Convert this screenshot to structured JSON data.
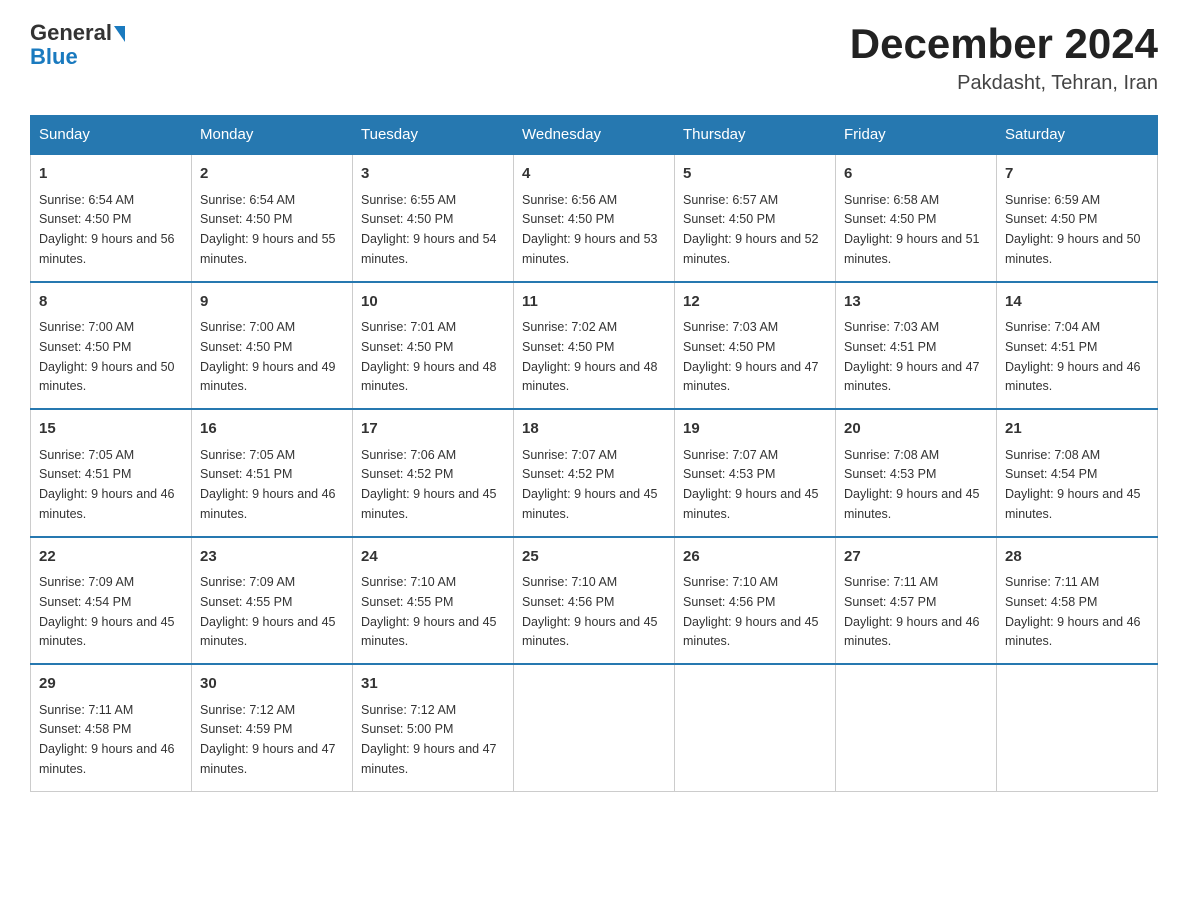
{
  "header": {
    "logo_text_main": "General",
    "logo_text_blue": "Blue",
    "month_title": "December 2024",
    "location": "Pakdasht, Tehran, Iran"
  },
  "weekdays": [
    "Sunday",
    "Monday",
    "Tuesday",
    "Wednesday",
    "Thursday",
    "Friday",
    "Saturday"
  ],
  "weeks": [
    [
      {
        "day": "1",
        "sunrise": "6:54 AM",
        "sunset": "4:50 PM",
        "daylight": "9 hours and 56 minutes."
      },
      {
        "day": "2",
        "sunrise": "6:54 AM",
        "sunset": "4:50 PM",
        "daylight": "9 hours and 55 minutes."
      },
      {
        "day": "3",
        "sunrise": "6:55 AM",
        "sunset": "4:50 PM",
        "daylight": "9 hours and 54 minutes."
      },
      {
        "day": "4",
        "sunrise": "6:56 AM",
        "sunset": "4:50 PM",
        "daylight": "9 hours and 53 minutes."
      },
      {
        "day": "5",
        "sunrise": "6:57 AM",
        "sunset": "4:50 PM",
        "daylight": "9 hours and 52 minutes."
      },
      {
        "day": "6",
        "sunrise": "6:58 AM",
        "sunset": "4:50 PM",
        "daylight": "9 hours and 51 minutes."
      },
      {
        "day": "7",
        "sunrise": "6:59 AM",
        "sunset": "4:50 PM",
        "daylight": "9 hours and 50 minutes."
      }
    ],
    [
      {
        "day": "8",
        "sunrise": "7:00 AM",
        "sunset": "4:50 PM",
        "daylight": "9 hours and 50 minutes."
      },
      {
        "day": "9",
        "sunrise": "7:00 AM",
        "sunset": "4:50 PM",
        "daylight": "9 hours and 49 minutes."
      },
      {
        "day": "10",
        "sunrise": "7:01 AM",
        "sunset": "4:50 PM",
        "daylight": "9 hours and 48 minutes."
      },
      {
        "day": "11",
        "sunrise": "7:02 AM",
        "sunset": "4:50 PM",
        "daylight": "9 hours and 48 minutes."
      },
      {
        "day": "12",
        "sunrise": "7:03 AM",
        "sunset": "4:50 PM",
        "daylight": "9 hours and 47 minutes."
      },
      {
        "day": "13",
        "sunrise": "7:03 AM",
        "sunset": "4:51 PM",
        "daylight": "9 hours and 47 minutes."
      },
      {
        "day": "14",
        "sunrise": "7:04 AM",
        "sunset": "4:51 PM",
        "daylight": "9 hours and 46 minutes."
      }
    ],
    [
      {
        "day": "15",
        "sunrise": "7:05 AM",
        "sunset": "4:51 PM",
        "daylight": "9 hours and 46 minutes."
      },
      {
        "day": "16",
        "sunrise": "7:05 AM",
        "sunset": "4:51 PM",
        "daylight": "9 hours and 46 minutes."
      },
      {
        "day": "17",
        "sunrise": "7:06 AM",
        "sunset": "4:52 PM",
        "daylight": "9 hours and 45 minutes."
      },
      {
        "day": "18",
        "sunrise": "7:07 AM",
        "sunset": "4:52 PM",
        "daylight": "9 hours and 45 minutes."
      },
      {
        "day": "19",
        "sunrise": "7:07 AM",
        "sunset": "4:53 PM",
        "daylight": "9 hours and 45 minutes."
      },
      {
        "day": "20",
        "sunrise": "7:08 AM",
        "sunset": "4:53 PM",
        "daylight": "9 hours and 45 minutes."
      },
      {
        "day": "21",
        "sunrise": "7:08 AM",
        "sunset": "4:54 PM",
        "daylight": "9 hours and 45 minutes."
      }
    ],
    [
      {
        "day": "22",
        "sunrise": "7:09 AM",
        "sunset": "4:54 PM",
        "daylight": "9 hours and 45 minutes."
      },
      {
        "day": "23",
        "sunrise": "7:09 AM",
        "sunset": "4:55 PM",
        "daylight": "9 hours and 45 minutes."
      },
      {
        "day": "24",
        "sunrise": "7:10 AM",
        "sunset": "4:55 PM",
        "daylight": "9 hours and 45 minutes."
      },
      {
        "day": "25",
        "sunrise": "7:10 AM",
        "sunset": "4:56 PM",
        "daylight": "9 hours and 45 minutes."
      },
      {
        "day": "26",
        "sunrise": "7:10 AM",
        "sunset": "4:56 PM",
        "daylight": "9 hours and 45 minutes."
      },
      {
        "day": "27",
        "sunrise": "7:11 AM",
        "sunset": "4:57 PM",
        "daylight": "9 hours and 46 minutes."
      },
      {
        "day": "28",
        "sunrise": "7:11 AM",
        "sunset": "4:58 PM",
        "daylight": "9 hours and 46 minutes."
      }
    ],
    [
      {
        "day": "29",
        "sunrise": "7:11 AM",
        "sunset": "4:58 PM",
        "daylight": "9 hours and 46 minutes."
      },
      {
        "day": "30",
        "sunrise": "7:12 AM",
        "sunset": "4:59 PM",
        "daylight": "9 hours and 47 minutes."
      },
      {
        "day": "31",
        "sunrise": "7:12 AM",
        "sunset": "5:00 PM",
        "daylight": "9 hours and 47 minutes."
      },
      {
        "day": "",
        "sunrise": "",
        "sunset": "",
        "daylight": ""
      },
      {
        "day": "",
        "sunrise": "",
        "sunset": "",
        "daylight": ""
      },
      {
        "day": "",
        "sunrise": "",
        "sunset": "",
        "daylight": ""
      },
      {
        "day": "",
        "sunrise": "",
        "sunset": "",
        "daylight": ""
      }
    ]
  ],
  "labels": {
    "sunrise_prefix": "Sunrise: ",
    "sunset_prefix": "Sunset: ",
    "daylight_prefix": "Daylight: "
  }
}
